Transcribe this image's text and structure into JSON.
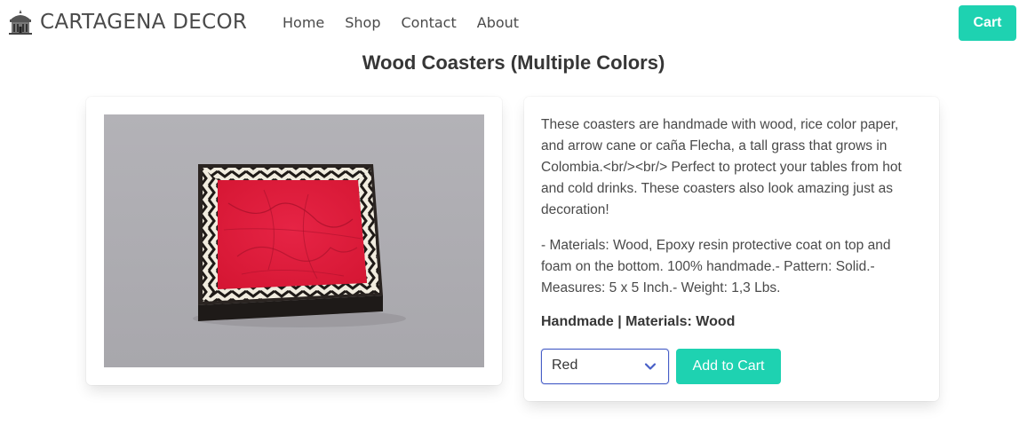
{
  "nav": {
    "brand_name": "CARTAGENA DECOR",
    "brand_icon": "building-icon",
    "links": [
      "Home",
      "Shop",
      "Contact",
      "About"
    ],
    "cart_label": "Cart"
  },
  "product": {
    "title": "Wood Coasters (Multiple Colors)",
    "description": "These coasters are handmade with wood, rice color paper, and arrow cane or caña Flecha, a tall grass that grows in Colombia.<br/><br/> Perfect to protect your tables from hot and cold drinks. These coasters also look amazing just as decoration!",
    "details": "- Materials: Wood, Epoxy resin protective coat on top and foam on the bottom. 100% handmade.- Pattern: Solid.- Measures: 5 x 5 Inch.- Weight: 1,3 Lbs.",
    "meta": "Handmade | Materials: Wood",
    "color_select": {
      "selected": "Red"
    },
    "add_to_cart_label": "Add to Cart"
  },
  "colors": {
    "accent": "#1ed2b1",
    "select_border": "#485fc7",
    "text": "#4a4a4a",
    "heading": "#363636",
    "coaster_red": "#e21c3c"
  }
}
